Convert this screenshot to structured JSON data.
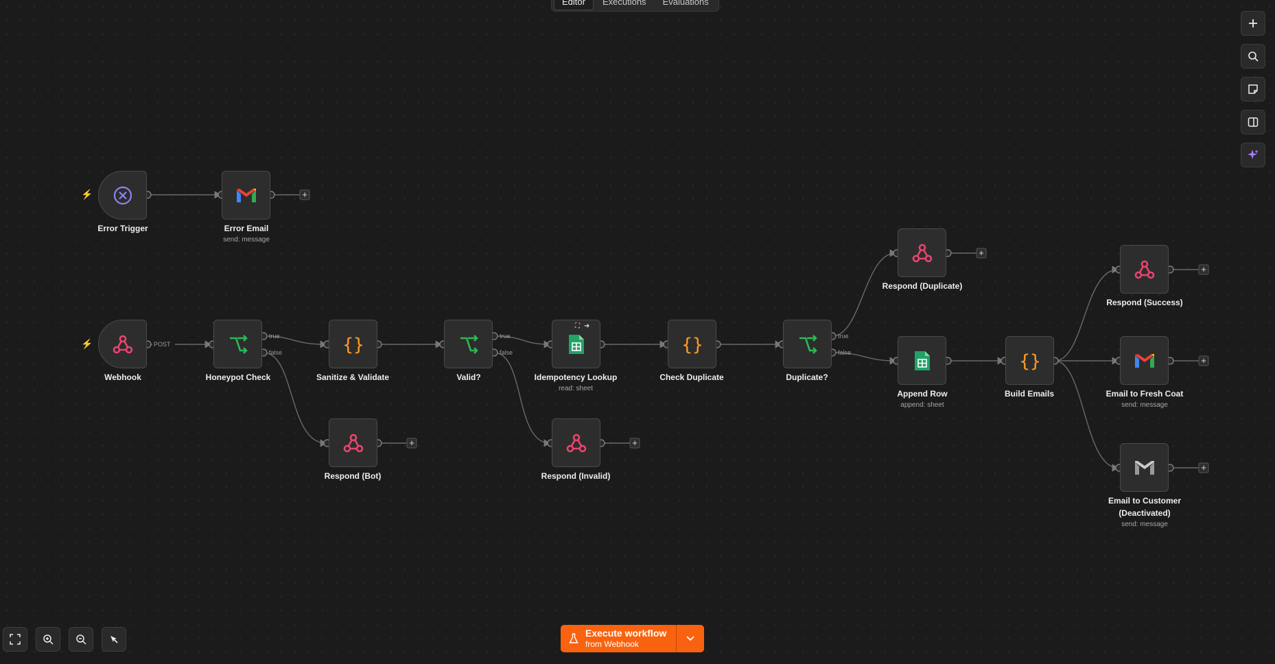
{
  "tabs": [
    "Editor",
    "Executions",
    "Evaluations"
  ],
  "nodes": {
    "error_trigger": {
      "label": "Error Trigger",
      "icon": "error-trigger-icon"
    },
    "error_email": {
      "label": "Error Email",
      "sub": "send: message",
      "icon": "gmail-icon"
    },
    "webhook": {
      "label": "Webhook",
      "icon": "webhook-icon"
    },
    "honeypot": {
      "label": "Honeypot Check",
      "icon": "if-branch-icon"
    },
    "sanitize": {
      "label": "Sanitize & Validate",
      "icon": "code-braces-icon"
    },
    "valid": {
      "label": "Valid?",
      "icon": "if-branch-icon"
    },
    "idempotency": {
      "label": "Idempotency Lookup",
      "sub": "read: sheet",
      "icon": "google-sheets-icon"
    },
    "check_duplicate": {
      "label": "Check Duplicate",
      "icon": "code-braces-icon"
    },
    "duplicate": {
      "label": "Duplicate?",
      "icon": "if-branch-icon"
    },
    "respond_bot": {
      "label": "Respond (Bot)",
      "icon": "webhook-icon"
    },
    "respond_invalid": {
      "label": "Respond (Invalid)",
      "icon": "webhook-icon"
    },
    "respond_duplicate": {
      "label": "Respond (Duplicate)",
      "icon": "webhook-icon"
    },
    "append_row": {
      "label": "Append Row",
      "sub": "append: sheet",
      "icon": "google-sheets-icon"
    },
    "build_emails": {
      "label": "Build Emails",
      "icon": "code-braces-icon"
    },
    "respond_success": {
      "label": "Respond (Success)",
      "icon": "webhook-icon"
    },
    "email_fresh_coat": {
      "label": "Email to Fresh Coat",
      "sub": "send: message",
      "icon": "gmail-icon"
    },
    "email_customer_l1": "Email to Customer",
    "email_customer_l2": "(Deactivated)",
    "email_customer_sub": "send: message"
  },
  "edge_labels": {
    "post": "POST",
    "true": "true",
    "false": "false"
  },
  "execute": {
    "title": "Execute workflow",
    "sub": "from Webhook"
  },
  "right_toolbar": [
    "plus-icon",
    "search-icon",
    "sticky-note-icon",
    "panel-icon",
    "ai-sparkle-icon"
  ],
  "bottom_toolbar": [
    "fit-view-icon",
    "zoom-in-icon",
    "zoom-out-icon",
    "tidy-up-icon"
  ],
  "colors": {
    "accent": "#f9620e",
    "webhook": "#e8456f",
    "if": "#2db855",
    "code": "#ff9b28",
    "sheets": "#21a366",
    "error": "#8b86f0"
  }
}
